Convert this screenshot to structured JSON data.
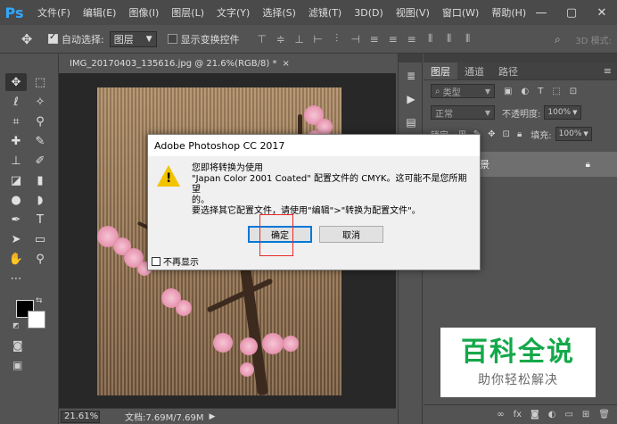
{
  "menubar": {
    "logo": "Ps",
    "items": [
      "文件(F)",
      "编辑(E)",
      "图像(I)",
      "图层(L)",
      "文字(Y)",
      "选择(S)",
      "滤镜(T)",
      "3D(D)",
      "视图(V)",
      "窗口(W)",
      "帮助(H)"
    ]
  },
  "options": {
    "auto_select_label": "自动选择:",
    "auto_select_value": "图层",
    "show_transform_label": "显示变换控件",
    "mode_3d": "3D 模式:"
  },
  "document": {
    "tab_title": "IMG_20170403_135616.jpg @ 21.6%(RGB/8) *",
    "close": "×"
  },
  "status": {
    "zoom": "21.61%",
    "doc_size": "文档:7.69M/7.69M"
  },
  "layers_panel": {
    "tabs": [
      "图层",
      "通道",
      "路径"
    ],
    "filter_kind": "类型",
    "blend_mode": "正常",
    "opacity_label": "不透明度:",
    "opacity_value": "100%",
    "lock_label": "锁定:",
    "fill_label": "填充:",
    "fill_value": "100%",
    "layer_name": "背景"
  },
  "dialog": {
    "title": "Adobe Photoshop CC 2017",
    "line1": "您即将转换为使用",
    "line2": "\"Japan Color 2001 Coated\" 配置文件的 CMYK。这可能不是您所期望",
    "line3": "的。",
    "line4": "要选择其它配置文件，请使用\"编辑\">\"转换为配置文件\"。",
    "ok": "确定",
    "cancel": "取消",
    "dont_show": "不再显示"
  },
  "watermark": {
    "title": "百科全说",
    "subtitle": "助你轻松解决"
  },
  "colors": {
    "ps_blue": "#31a8ff",
    "focus_blue": "#0078d7",
    "highlight_red": "#e82828",
    "warning_yellow": "#f3c300",
    "watermark_green": "#14a84a"
  }
}
